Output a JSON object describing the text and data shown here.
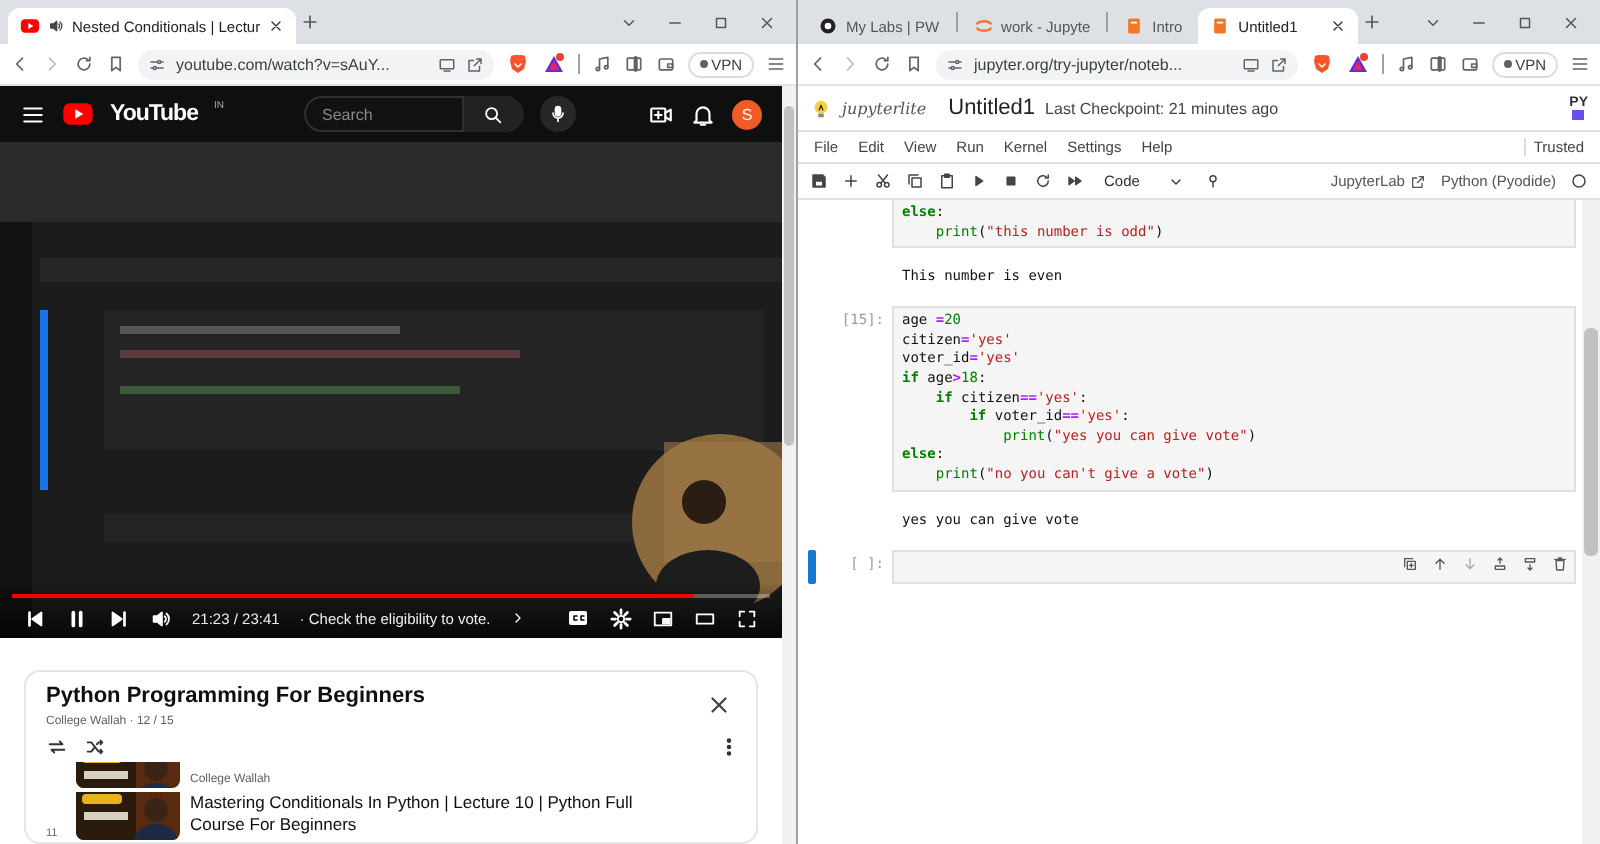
{
  "left_window": {
    "tabs": [
      {
        "kind": "video",
        "title": "Nested Conditionals | Lectur",
        "audio": true,
        "selected": true
      }
    ],
    "address": "youtube.com/watch?v=sAuY...",
    "vpn": "VPN",
    "youtube": {
      "logo": "YouTube",
      "region": "IN",
      "search_placeholder": "Search",
      "avatar": "S",
      "player": {
        "progress": {
          "level": 0.9
        },
        "playing": true,
        "time": "21:23 / 23:41",
        "chapter": "· Check the eligibility to vote."
      },
      "playlist": {
        "title": "Python Programming For Beginners",
        "meta": "College Wallah · 12 / 15",
        "items": [
          {
            "channel": "College Wallah"
          },
          {
            "index": "11",
            "title": "Mastering Conditionals In Python | Lecture 10 | Python Full Course For Beginners"
          }
        ]
      }
    }
  },
  "right_window": {
    "tabs": [
      {
        "kind": "labs",
        "title": "My Labs | PW",
        "selected": false
      },
      {
        "kind": "jupyter",
        "title": "work - Jupyte",
        "selected": false
      },
      {
        "kind": "notebook",
        "title": "Intro",
        "selected": false
      },
      {
        "kind": "notebook",
        "title": "Untitled1",
        "selected": true
      }
    ],
    "address": "jupyter.org/try-jupyter/noteb...",
    "vpn": "VPN",
    "jupyterlite": {
      "logo": "jupyterlite",
      "title": "Untitled1",
      "checkpoint": "Last Checkpoint: 21 minutes ago",
      "kernel_badge": "PY",
      "menu": [
        "File",
        "Edit",
        "View",
        "Run",
        "Kernel",
        "Settings",
        "Help"
      ],
      "trusted": "Trusted",
      "cell_type": "Code",
      "open_in": "JupyterLab",
      "kernel": "Python (Pyodide)",
      "cells": [
        {
          "active": false,
          "code": [
            [
              {
                "text": "else",
                "kind": "keyword"
              },
              {
                "text": ":",
                "kind": "name"
              }
            ],
            [
              {
                "text": "    print",
                "kind": "builtin"
              },
              {
                "text": "(",
                "kind": "name"
              },
              {
                "text": "\"this number is odd\"",
                "kind": "string"
              },
              {
                "text": ")",
                "kind": "name"
              }
            ]
          ],
          "output": "This number is even"
        },
        {
          "active": false,
          "prompt": "[15]:",
          "code": [
            [
              {
                "text": "age ",
                "kind": "name"
              },
              {
                "text": "=",
                "kind": "operator"
              },
              {
                "text": "20",
                "kind": "number"
              }
            ],
            [
              {
                "text": "citizen",
                "kind": "name"
              },
              {
                "text": "=",
                "kind": "operator"
              },
              {
                "text": "'yes'",
                "kind": "string"
              }
            ],
            [
              {
                "text": "voter_id",
                "kind": "name"
              },
              {
                "text": "=",
                "kind": "operator"
              },
              {
                "text": "'yes'",
                "kind": "string"
              }
            ],
            [
              {
                "text": "if",
                "kind": "keyword"
              },
              {
                "text": " age",
                "kind": "name"
              },
              {
                "text": ">",
                "kind": "operator"
              },
              {
                "text": "18",
                "kind": "number"
              },
              {
                "text": ":",
                "kind": "name"
              }
            ],
            [
              {
                "text": "    if",
                "kind": "keyword"
              },
              {
                "text": " citizen",
                "kind": "name"
              },
              {
                "text": "==",
                "kind": "operator"
              },
              {
                "text": "'yes'",
                "kind": "string"
              },
              {
                "text": ":",
                "kind": "name"
              }
            ],
            [
              {
                "text": "        if",
                "kind": "keyword"
              },
              {
                "text": " voter_id",
                "kind": "name"
              },
              {
                "text": "==",
                "kind": "operator"
              },
              {
                "text": "'yes'",
                "kind": "string"
              },
              {
                "text": ":",
                "kind": "name"
              }
            ],
            [
              {
                "text": "            print",
                "kind": "builtin"
              },
              {
                "text": "(",
                "kind": "name"
              },
              {
                "text": "\"yes you can give vote\"",
                "kind": "string"
              },
              {
                "text": ")",
                "kind": "name"
              }
            ],
            [
              {
                "text": "else",
                "kind": "keyword"
              },
              {
                "text": ":",
                "kind": "name"
              }
            ],
            [
              {
                "text": "    print",
                "kind": "builtin"
              },
              {
                "text": "(",
                "kind": "name"
              },
              {
                "text": "\"no you can't give a vote\"",
                "kind": "string"
              },
              {
                "text": ")",
                "kind": "name"
              }
            ]
          ],
          "output": "yes you can give vote"
        },
        {
          "active": true,
          "prompt": "[ ]:"
        }
      ]
    }
  }
}
